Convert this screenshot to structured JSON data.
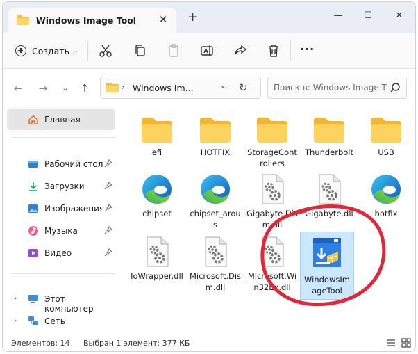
{
  "tab": {
    "title": "Windows Image Tool",
    "close": "✕",
    "new": "+"
  },
  "window": {
    "minimize": "—",
    "maximize": "☐",
    "close": "✕"
  },
  "toolbar": {
    "create_label": "Создать",
    "more": "···"
  },
  "address": {
    "path": "Windows Im...",
    "search_placeholder": "Поиск в: Windows Image T..."
  },
  "sidebar": {
    "home": "Главная",
    "items": [
      "Рабочий стол",
      "Загрузки",
      "Изображения",
      "Музыка",
      "Видео"
    ],
    "this_pc": "Этот компьютер",
    "network": "Сеть"
  },
  "files": [
    {
      "name": "efi",
      "type": "folder"
    },
    {
      "name": "HOTFIX",
      "type": "folder"
    },
    {
      "name": "StorageControllers",
      "type": "folder"
    },
    {
      "name": "Thunderbolt",
      "type": "folder"
    },
    {
      "name": "USB",
      "type": "folder"
    },
    {
      "name": "chipset",
      "type": "edge"
    },
    {
      "name": "chipset_arous",
      "type": "edge"
    },
    {
      "name": "Gigabyte.Dism.dll",
      "type": "dll"
    },
    {
      "name": "Gigabyte.dll",
      "type": "dll"
    },
    {
      "name": "hotfix",
      "type": "edge"
    },
    {
      "name": "IoWrapper.dll",
      "type": "dll"
    },
    {
      "name": "Microsoft.Dism.dll",
      "type": "dll"
    },
    {
      "name": "Microsoft.Win32Ex.dll",
      "type": "dll"
    },
    {
      "name": "WindowsImageTool",
      "type": "app",
      "selected": true
    }
  ],
  "status": {
    "count": "Элементов: 14",
    "selected": "Выбран 1 элемент: 377 КБ"
  },
  "colors": {
    "accent": "#0067c0",
    "annotation": "#e0283a",
    "selection": "#cce8ff"
  }
}
